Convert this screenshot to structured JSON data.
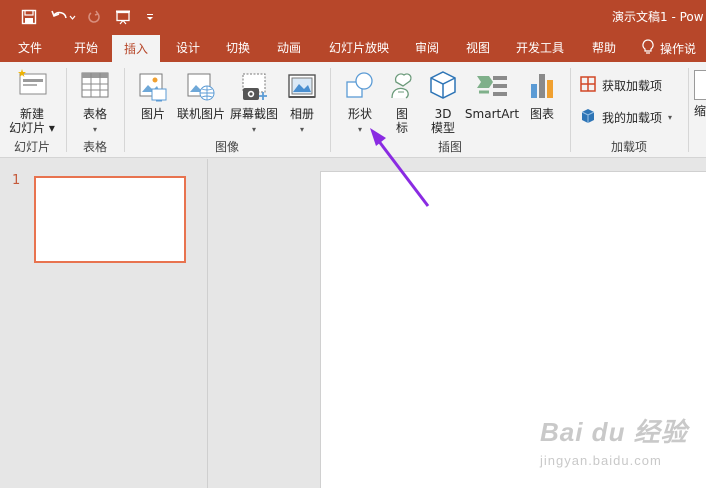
{
  "title_bar": {
    "document_title": "演示文稿1  -  Pow",
    "quick_access": [
      "save-icon",
      "undo-icon",
      "redo-icon",
      "present-icon",
      "customize-icon"
    ]
  },
  "tabs": [
    {
      "label": "文件",
      "active": false
    },
    {
      "label": "开始",
      "active": false
    },
    {
      "label": "插入",
      "active": true
    },
    {
      "label": "设计",
      "active": false
    },
    {
      "label": "切换",
      "active": false
    },
    {
      "label": "动画",
      "active": false
    },
    {
      "label": "幻灯片放映",
      "active": false
    },
    {
      "label": "审阅",
      "active": false
    },
    {
      "label": "视图",
      "active": false
    },
    {
      "label": "开发工具",
      "active": false
    },
    {
      "label": "帮助",
      "active": false
    }
  ],
  "tell_me": {
    "label": "操作说",
    "icon": "lightbulb-icon"
  },
  "ribbon": {
    "groups": {
      "slides": "幻灯片",
      "tables": "表格",
      "images": "图像",
      "illustrations": "插图",
      "addins": "加载项"
    },
    "buttons": {
      "new_slide_line1": "新建",
      "new_slide_line2": "幻灯片",
      "table": "表格",
      "pictures": "图片",
      "online_pictures": "联机图片",
      "screenshot": "屏幕截图",
      "album": "相册",
      "shapes": "形状",
      "icons_line1": "图",
      "icons_line2": "标",
      "model3d_line1": "3D",
      "model3d_line2": "模型",
      "smartart": "SmartArt",
      "chart": "图表",
      "get_addins": "获取加载项",
      "my_addins": "我的加载项",
      "cut_off": "缩"
    }
  },
  "slides_pane": {
    "slide_number": "1"
  },
  "watermark": {
    "main": "Bai du 经验",
    "sub": "jingyan.baidu.com"
  },
  "colors": {
    "accent": "#b7472a",
    "arrow": "#8a2be2",
    "thumb_border": "#e8734f"
  }
}
